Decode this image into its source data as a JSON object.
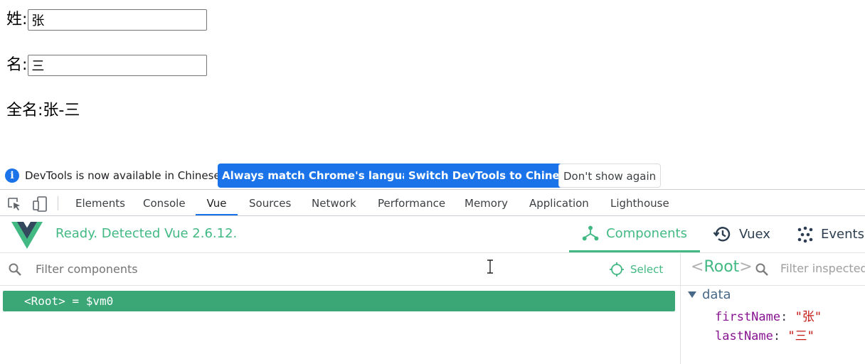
{
  "page": {
    "surname_label": "姓:",
    "surname_value": "张",
    "given_label": "名:",
    "given_value": "三",
    "fullname_label": "全名:",
    "fullname_value": "张-三"
  },
  "notice": {
    "icon": "info-icon",
    "text": "DevTools is now available in Chinese!",
    "btn_match": "Always match Chrome's language",
    "btn_switch": "Switch DevTools to Chinese",
    "btn_dismiss": "Don't show again"
  },
  "devtools_tabs": [
    "Elements",
    "Console",
    "Vue",
    "Sources",
    "Network",
    "Performance",
    "Memory",
    "Application",
    "Lighthouse"
  ],
  "devtools_active_tab": "Vue",
  "vue": {
    "status": "Ready. Detected Vue 2.6.12.",
    "tab_components": "Components",
    "tab_vuex": "Vuex",
    "tab_events": "Events",
    "accent": "#42b983",
    "filter_placeholder": "Filter components",
    "select_label": "Select",
    "root_row": "<Root> = $vm0",
    "inspector_title_open": "<",
    "inspector_title": "Root",
    "inspector_title_close": ">",
    "inspector_filter": "Filter inspected d",
    "data_label": "data",
    "props": [
      {
        "key": "firstName",
        "value": "\"张\""
      },
      {
        "key": "lastName",
        "value": "\"三\""
      }
    ]
  }
}
